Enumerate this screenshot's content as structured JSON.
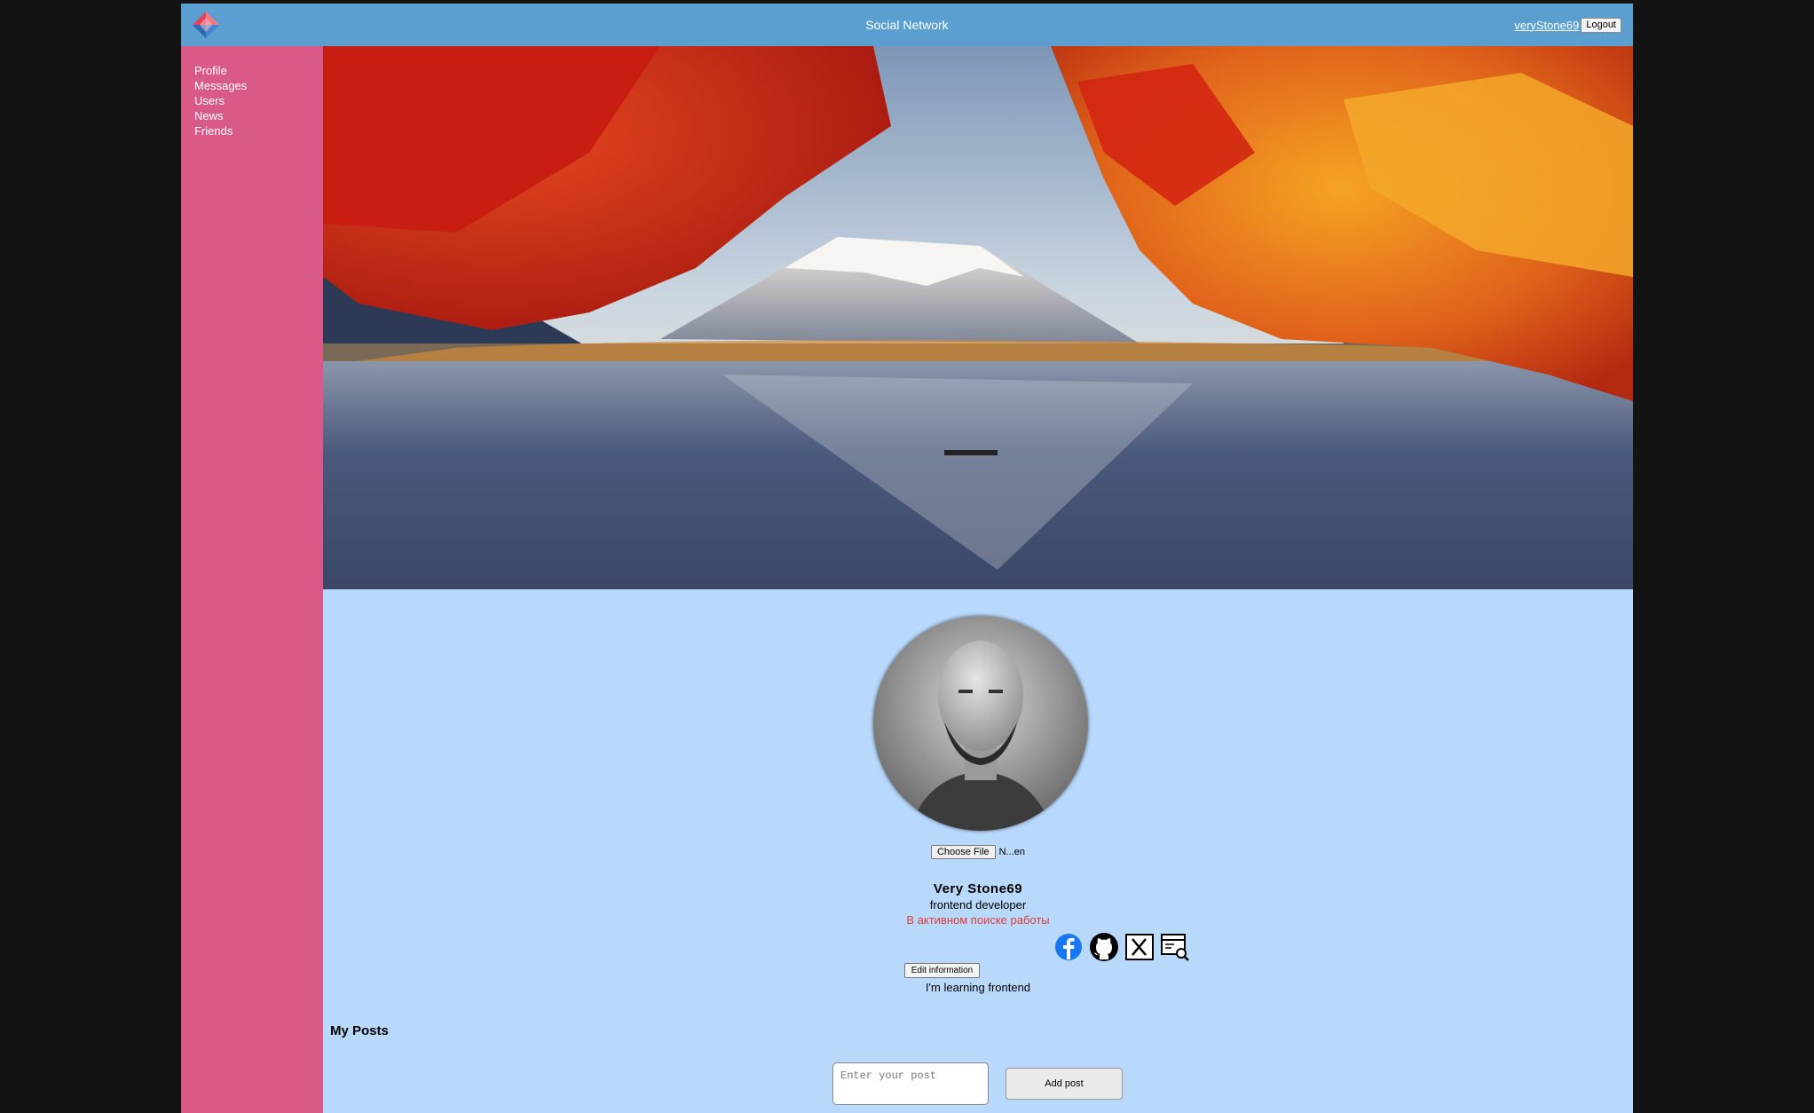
{
  "header": {
    "app_title": "Social Network",
    "login_name": "veryStone69",
    "logout_label": "Logout",
    "logo_icon": "diamond-logo-icon"
  },
  "sidebar": {
    "items": [
      {
        "label": "Profile"
      },
      {
        "label": "Messages"
      },
      {
        "label": "Users"
      },
      {
        "label": "News"
      },
      {
        "label": "Friends"
      }
    ]
  },
  "profile": {
    "cover_image": "autumn-lake-mountain-photo",
    "avatar_image": "bearded-man-portrait-photo",
    "choose_file_label": "Choose File",
    "file_name": "N...en",
    "full_name": "Very Stone69",
    "job": "frontend developer",
    "job_status": "В активном поиске работы",
    "socials": [
      {
        "icon": "facebook-icon"
      },
      {
        "icon": "github-icon"
      },
      {
        "icon": "x-twitter-icon"
      },
      {
        "icon": "website-search-icon"
      }
    ],
    "edit_label": "Edit information",
    "about": "I'm learning frontend"
  },
  "posts": {
    "title": "My Posts",
    "placeholder": "Enter your post",
    "add_label": "Add post"
  },
  "colors": {
    "page_bg": "#131313",
    "header": "#5a9fd0",
    "sidebar": "#d95a88",
    "content": "#b8d9fc",
    "status": "#e03c3c"
  }
}
